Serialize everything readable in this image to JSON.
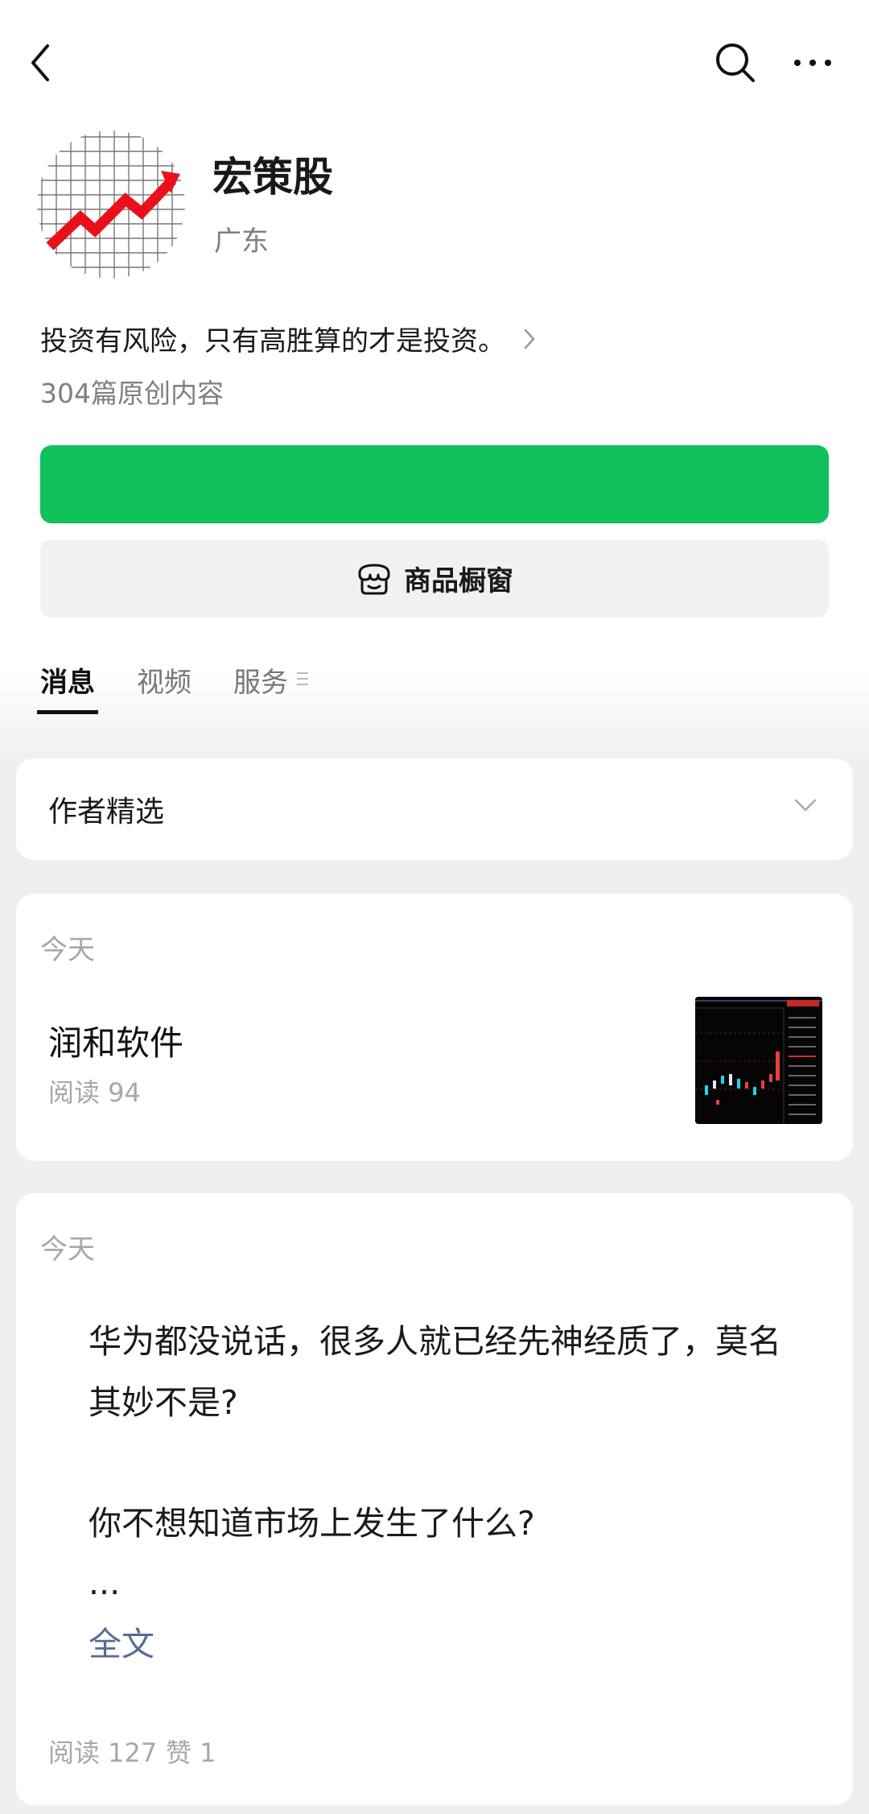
{
  "topbar": {
    "back_icon": "chevron-left-icon",
    "search_icon": "search-icon",
    "more_icon": "more-dots-icon"
  },
  "profile": {
    "name": "宏策股",
    "region": "广东",
    "bio": "投资有风险，只有高胜算的才是投资。",
    "original_count": "304篇原创内容"
  },
  "buttons": {
    "shop_label": "商品橱窗",
    "follow_color": "#10c15c"
  },
  "tabs": [
    {
      "label": "消息",
      "active": true
    },
    {
      "label": "视频",
      "active": false
    },
    {
      "label": "服务",
      "active": false
    }
  ],
  "author_picks": {
    "label": "作者精选"
  },
  "articles": [
    {
      "date": "今天",
      "title": "润和软件",
      "stats": "阅读 94"
    }
  ],
  "posts": [
    {
      "date": "今天",
      "para1_line1": "华为都没说话，很多人就已经先神经质了，莫名",
      "para1_line2": "其妙不是?",
      "para2": "你不想知道市场上发生了什么?",
      "ellipsis": "...",
      "full_text_link": "全文",
      "reads": "阅读 127",
      "likes": "赞 1"
    }
  ],
  "colors": {
    "accent_green": "#10c15c",
    "link_blue": "#576b95",
    "muted": "#a8a8a8"
  }
}
